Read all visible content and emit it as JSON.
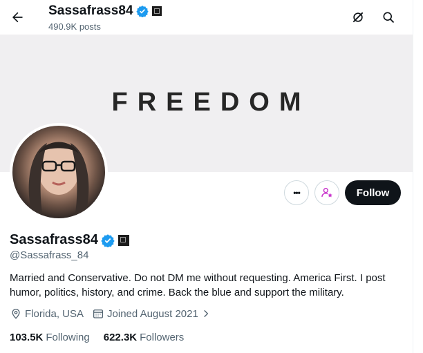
{
  "header": {
    "title": "Sassafrass84",
    "posts_count": "490.9K posts"
  },
  "banner": {
    "text": "FREEDOM"
  },
  "actions": {
    "more_label": "•••",
    "follow_label": "Follow"
  },
  "profile": {
    "display_name": "Sassafrass84",
    "handle": "@Sassafrass_84",
    "bio": "Married and Conservative. Do not DM me without requesting. America First. I post humor, politics, history, and crime. Back the blue and support the military.",
    "location": "Florida, USA",
    "joined": "Joined August 2021",
    "following_count": "103.5K",
    "following_label": "Following",
    "followers_count": "622.3K",
    "followers_label": "Followers"
  },
  "colors": {
    "verified_blue": "#1d9bf0",
    "subscribe_pink": "#c936cc",
    "follow_bg": "#0f1419",
    "secondary_text": "#536471"
  },
  "icons": [
    "back-arrow-icon",
    "grok-icon",
    "search-icon",
    "verified-badge-icon",
    "flag-icon",
    "more-icon",
    "subscribe-icon",
    "location-icon",
    "calendar-icon",
    "chevron-right-icon"
  ]
}
